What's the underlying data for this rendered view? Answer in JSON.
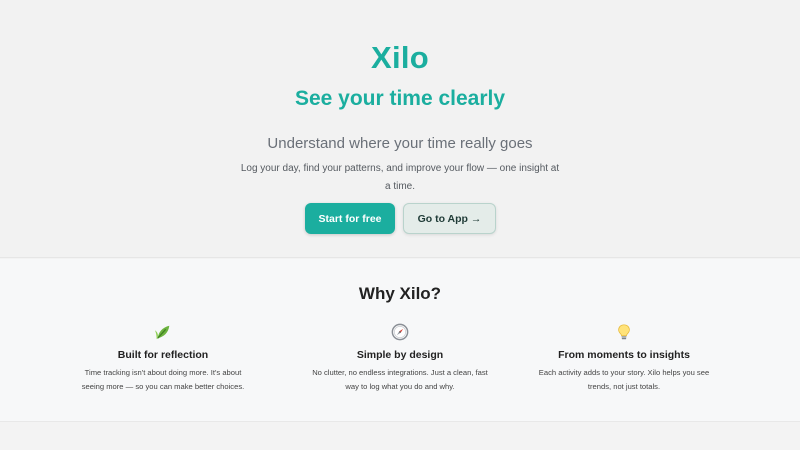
{
  "hero": {
    "brand": "Xilo",
    "headline": "See your time clearly",
    "subheadline": "Understand where your time really goes",
    "blurb": "Log your day, find your patterns, and improve your flow — one insight at a time.",
    "primary_button": "Start for free",
    "secondary_button": "Go to App →"
  },
  "features_section": {
    "title": "Why Xilo?",
    "items": [
      {
        "icon": "leaf-icon",
        "title": "Built for reflection",
        "description": "Time tracking isn't about doing more. It's about seeing more — so you can make better choices."
      },
      {
        "icon": "compass-icon",
        "title": "Simple by design",
        "description": "No clutter, no endless integrations. Just a clean, fast way to log what you do and why."
      },
      {
        "icon": "lightbulb-icon",
        "title": "From moments to insights",
        "description": "Each activity adds to your story. Xilo helps you see trends, not just totals."
      }
    ]
  },
  "colors": {
    "accent": "#1bae9f",
    "background": "#f2f2f2",
    "secondary_button_bg": "#e4ece9"
  }
}
